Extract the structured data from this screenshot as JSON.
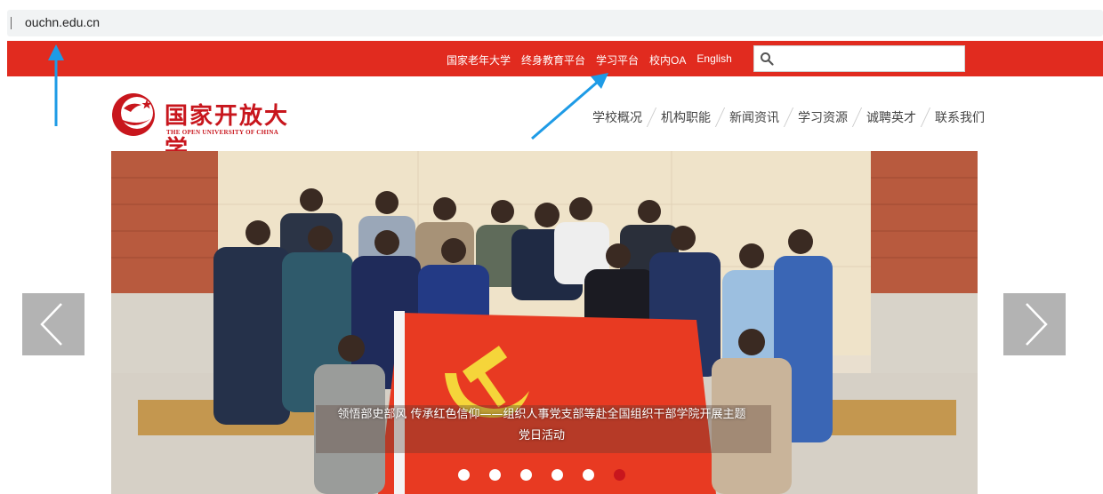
{
  "address_bar": {
    "url": "ouchn.edu.cn"
  },
  "top_links": [
    "国家老年大学",
    "终身教育平台",
    "学习平台",
    "校内OA",
    "English"
  ],
  "search": {
    "placeholder": "",
    "value": ""
  },
  "logo": {
    "name_cn": "国家开放大学",
    "name_en": "THE OPEN UNIVERSITY OF CHINA"
  },
  "main_nav": [
    "学校概况",
    "机构职能",
    "新闻资讯",
    "学习资源",
    "诚聘英才",
    "联系我们"
  ],
  "banner": {
    "caption_line1": "领悟部史部风 传承红色信仰——组织人事党支部等赴全国组织干部学院开展主题",
    "caption_line2": "党日活动",
    "slide_count": 6,
    "active_slide": 6
  },
  "colors": {
    "brand_red": "#e12b1f",
    "logo_red": "#c8161d",
    "annotation_blue": "#1e9be6"
  }
}
